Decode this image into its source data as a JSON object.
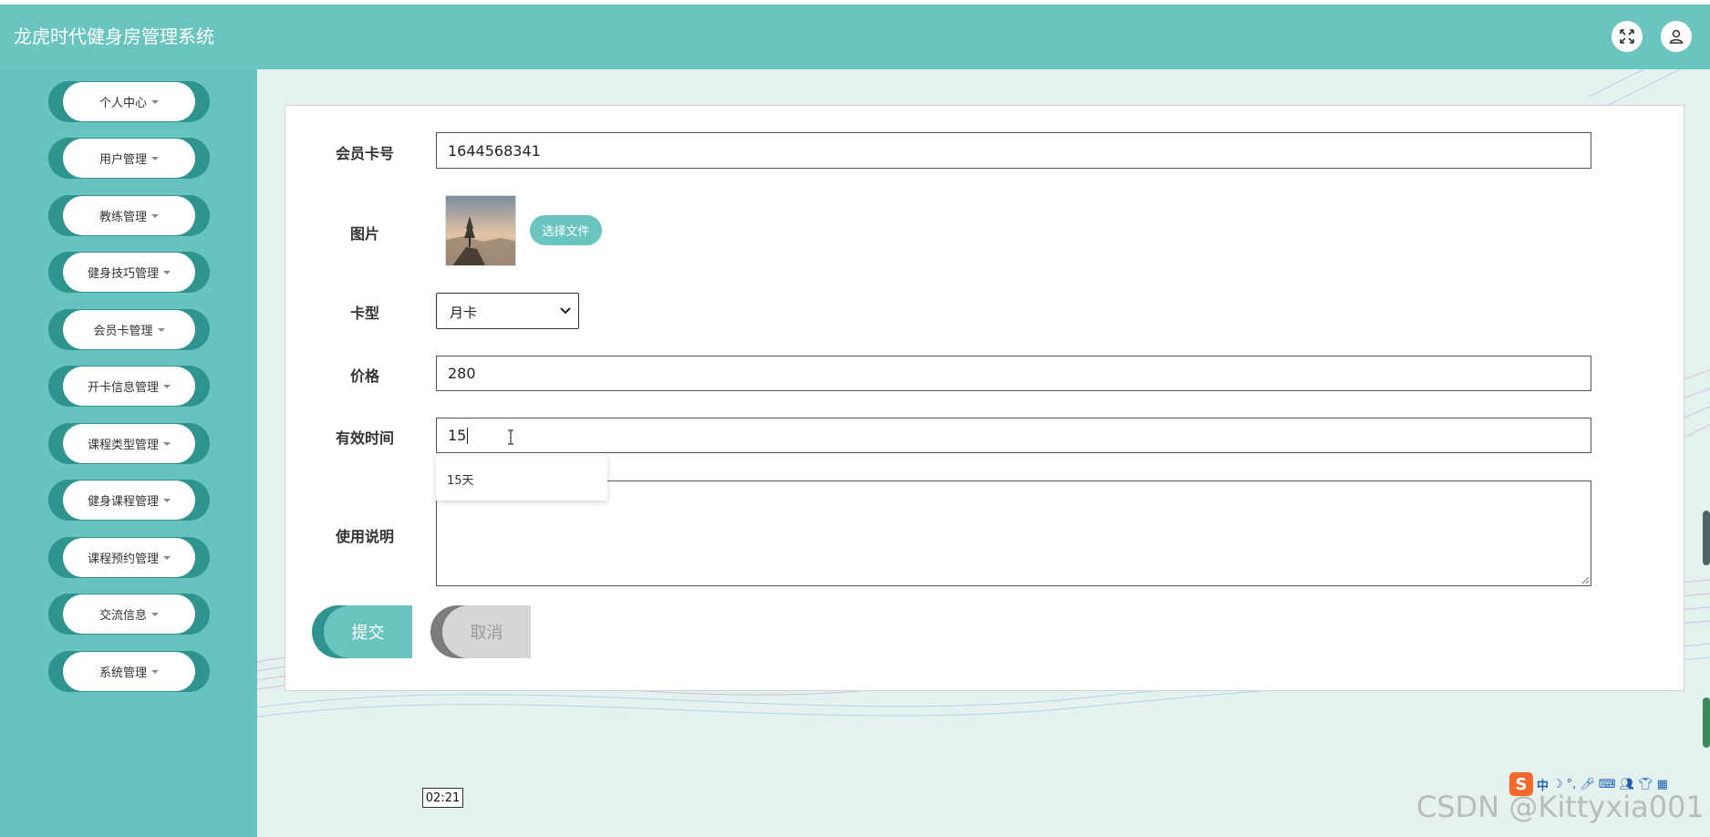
{
  "app": {
    "title": "龙虎时代健身房管理系统"
  },
  "header": {
    "fullscreen_icon": "expand-icon",
    "user_icon": "user-icon"
  },
  "sidebar": {
    "items": [
      {
        "label": "个人中心"
      },
      {
        "label": "用户管理"
      },
      {
        "label": "教练管理"
      },
      {
        "label": "健身技巧管理"
      },
      {
        "label": "会员卡管理"
      },
      {
        "label": "开卡信息管理"
      },
      {
        "label": "课程类型管理"
      },
      {
        "label": "健身课程管理"
      },
      {
        "label": "课程预约管理"
      },
      {
        "label": "交流信息"
      },
      {
        "label": "系统管理"
      }
    ]
  },
  "form": {
    "card_no_label": "会员卡号",
    "card_no_value": "1644568341",
    "image_label": "图片",
    "file_button": "选择文件",
    "card_type_label": "卡型",
    "card_type_value": "月卡",
    "price_label": "价格",
    "price_value": "280",
    "validity_label": "有效时间",
    "validity_value": "15",
    "validity_suggestion": "15天",
    "usage_label": "使用说明",
    "usage_value": "",
    "submit_label": "提交",
    "cancel_label": "取消"
  },
  "overlay": {
    "timestamp": "02:21",
    "watermark": "CSDN @Kittyxia001",
    "ime_logo": "S",
    "ime_mode": "中"
  },
  "colors": {
    "header_bg": "#6ac5c1",
    "sidebar_bg": "#66c3bf",
    "nav_accent": "#2f948e",
    "content_bg": "#e4f1ee"
  }
}
